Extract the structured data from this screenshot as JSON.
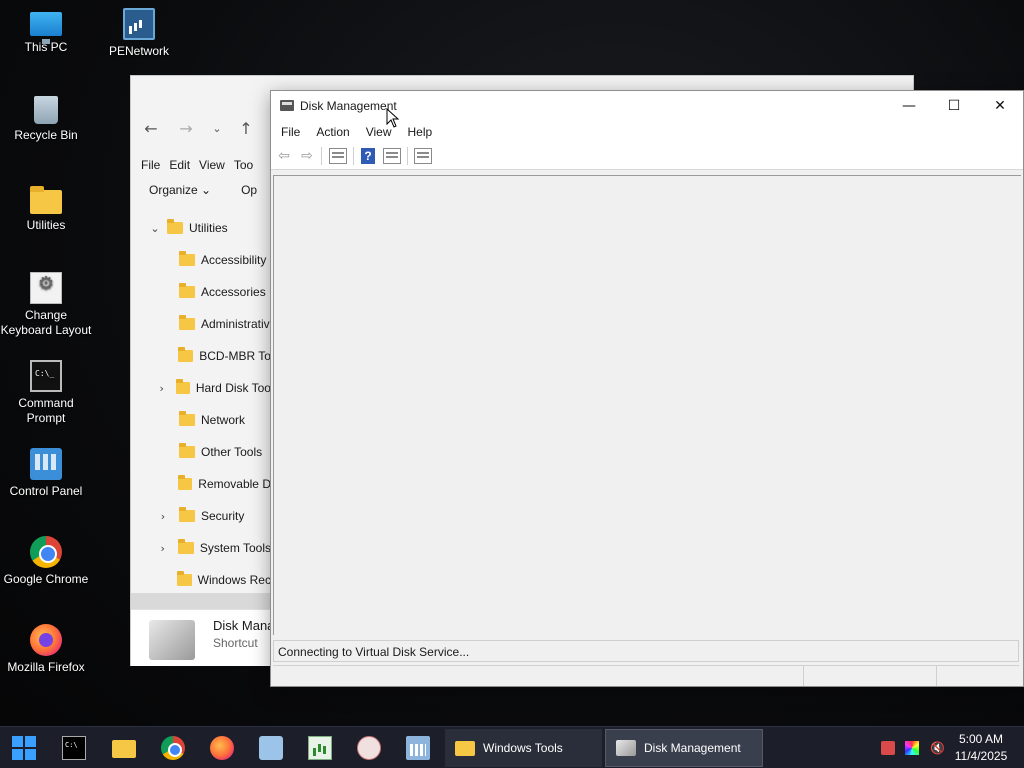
{
  "desktop": {
    "icons": [
      {
        "label": "This PC",
        "icon": "monitor-icon"
      },
      {
        "label": "PENetwork",
        "icon": "network-icon"
      },
      {
        "label": "Recycle Bin",
        "icon": "recycle-bin-icon"
      },
      {
        "label": "Utilities",
        "icon": "folder-icon"
      },
      {
        "label": "Change Keyboard Layout",
        "icon": "keyboard-settings-icon"
      },
      {
        "label": "Command Prompt",
        "icon": "command-prompt-icon"
      },
      {
        "label": "Control Panel",
        "icon": "control-panel-icon"
      },
      {
        "label": "Google Chrome",
        "icon": "chrome-icon"
      },
      {
        "label": "Mozilla Firefox",
        "icon": "firefox-icon"
      }
    ]
  },
  "explorer": {
    "menu": [
      "File",
      "Edit",
      "View",
      "Too"
    ],
    "cmdbar": {
      "organize": "Organize ⌄",
      "open": "Op"
    },
    "tree": [
      {
        "label": "Utilities",
        "caret": "⌄"
      },
      {
        "label": "Accessibility",
        "caret": ""
      },
      {
        "label": "Accessories",
        "caret": ""
      },
      {
        "label": "Administrativ",
        "caret": ""
      },
      {
        "label": "BCD-MBR To",
        "caret": ""
      },
      {
        "label": "Hard Disk Too",
        "caret": "›"
      },
      {
        "label": "Network",
        "caret": ""
      },
      {
        "label": "Other Tools",
        "caret": ""
      },
      {
        "label": "Removable D",
        "caret": ""
      },
      {
        "label": "Security",
        "caret": "›"
      },
      {
        "label": "System Tools",
        "caret": "›"
      },
      {
        "label": "Windows Rec",
        "caret": ""
      }
    ],
    "details": {
      "name": "Disk Mana",
      "type": "Shortcut"
    }
  },
  "disk_management": {
    "title": "Disk Management",
    "menu": [
      "File",
      "Action",
      "View",
      "Help"
    ],
    "status": "Connecting to Virtual Disk Service...",
    "controls": {
      "minimize": "—",
      "maximize": "☐",
      "close": "✕"
    }
  },
  "taskbar": {
    "windows_tools_label": "Windows Tools",
    "disk_management_label": "Disk Management",
    "time": "5:00 AM",
    "date": "11/4/2025"
  }
}
